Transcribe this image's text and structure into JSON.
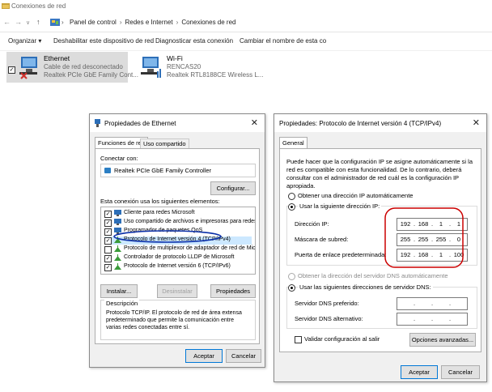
{
  "explorer": {
    "title": "Conexiones de red",
    "breadcrumb": [
      "Panel de control",
      "Redes e Internet",
      "Conexiones de red"
    ],
    "commands": [
      "Organizar ▾",
      "Deshabilitar este dispositivo de red",
      "Diagnosticar esta conexión",
      "Cambiar el nombre de esta co"
    ],
    "adapters": [
      {
        "name": "Ethernet",
        "status": "Cable de red desconectado",
        "device": "Realtek PCIe GbE Family Cont..."
      },
      {
        "name": "Wi-Fi",
        "status": "RENCAS20",
        "device": "Realtek RTL8188CE Wireless L..."
      }
    ]
  },
  "eth_dialog": {
    "title": "Propiedades de Ethernet",
    "tabs": [
      "Funciones de red",
      "Uso compartido"
    ],
    "connect_label": "Conectar con:",
    "adapter_name": "Realtek PCIe GbE Family Controller",
    "configure_button": "Configurar...",
    "elements_label": "Esta conexión usa los siguientes elementos:",
    "items": [
      {
        "label": "Cliente para redes Microsoft",
        "checked": true
      },
      {
        "label": "Uso compartido de archivos e impresoras para redes M",
        "checked": true
      },
      {
        "label": "Programador de paquetes QoS",
        "checked": true
      },
      {
        "label": "Protocolo de Internet versión 4 (TCP/IPv4)",
        "checked": true,
        "selected": true
      },
      {
        "label": "Protocolo de multiplexor de adaptador de red de Micros",
        "checked": false
      },
      {
        "label": "Controlador de protocolo LLDP de Microsoft",
        "checked": true
      },
      {
        "label": "Protocolo de Internet versión 6 (TCP/IPv6)",
        "checked": true
      }
    ],
    "buttons": {
      "install": "Instalar...",
      "uninstall": "Desinstalar",
      "properties": "Propiedades"
    },
    "description_title": "Descripción",
    "description_text": "Protocolo TCP/IP. El protocolo de red de área extensa predeterminado que permite la comunicación entre varias redes conectadas entre sí.",
    "accept": "Aceptar",
    "cancel": "Cancelar"
  },
  "ipv4_dialog": {
    "title": "Propiedades: Protocolo de Internet versión 4 (TCP/IPv4)",
    "tab": "General",
    "intro": "Puede hacer que la configuración IP se asigne automáticamente si la red es compatible con esta funcionalidad. De lo contrario, deberá consultar con el administrador de red cuál es la configuración IP apropiada.",
    "auto_ip": "Obtener una dirección IP automáticamente",
    "manual_ip": "Usar la siguiente dirección IP:",
    "ip_label": "Dirección IP:",
    "ip": [
      "192",
      "168",
      "1",
      "1"
    ],
    "mask_label": "Máscara de subred:",
    "mask": [
      "255",
      "255",
      "255",
      "0"
    ],
    "gateway_label": "Puerta de enlace predeterminada:",
    "gateway": [
      "192",
      "168",
      "1",
      "100"
    ],
    "auto_dns": "Obtener la dirección del servidor DNS automáticamente",
    "manual_dns": "Usar las siguientes direcciones de servidor DNS:",
    "dns_pref_label": "Servidor DNS preferido:",
    "dns_alt_label": "Servidor DNS alternativo:",
    "validate": "Validar configuración al salir",
    "advanced": "Opciones avanzadas...",
    "accept": "Aceptar",
    "cancel": "Cancelar"
  },
  "colors": {
    "accent": "#0078d7",
    "highlight_circle": "#cc0000"
  }
}
